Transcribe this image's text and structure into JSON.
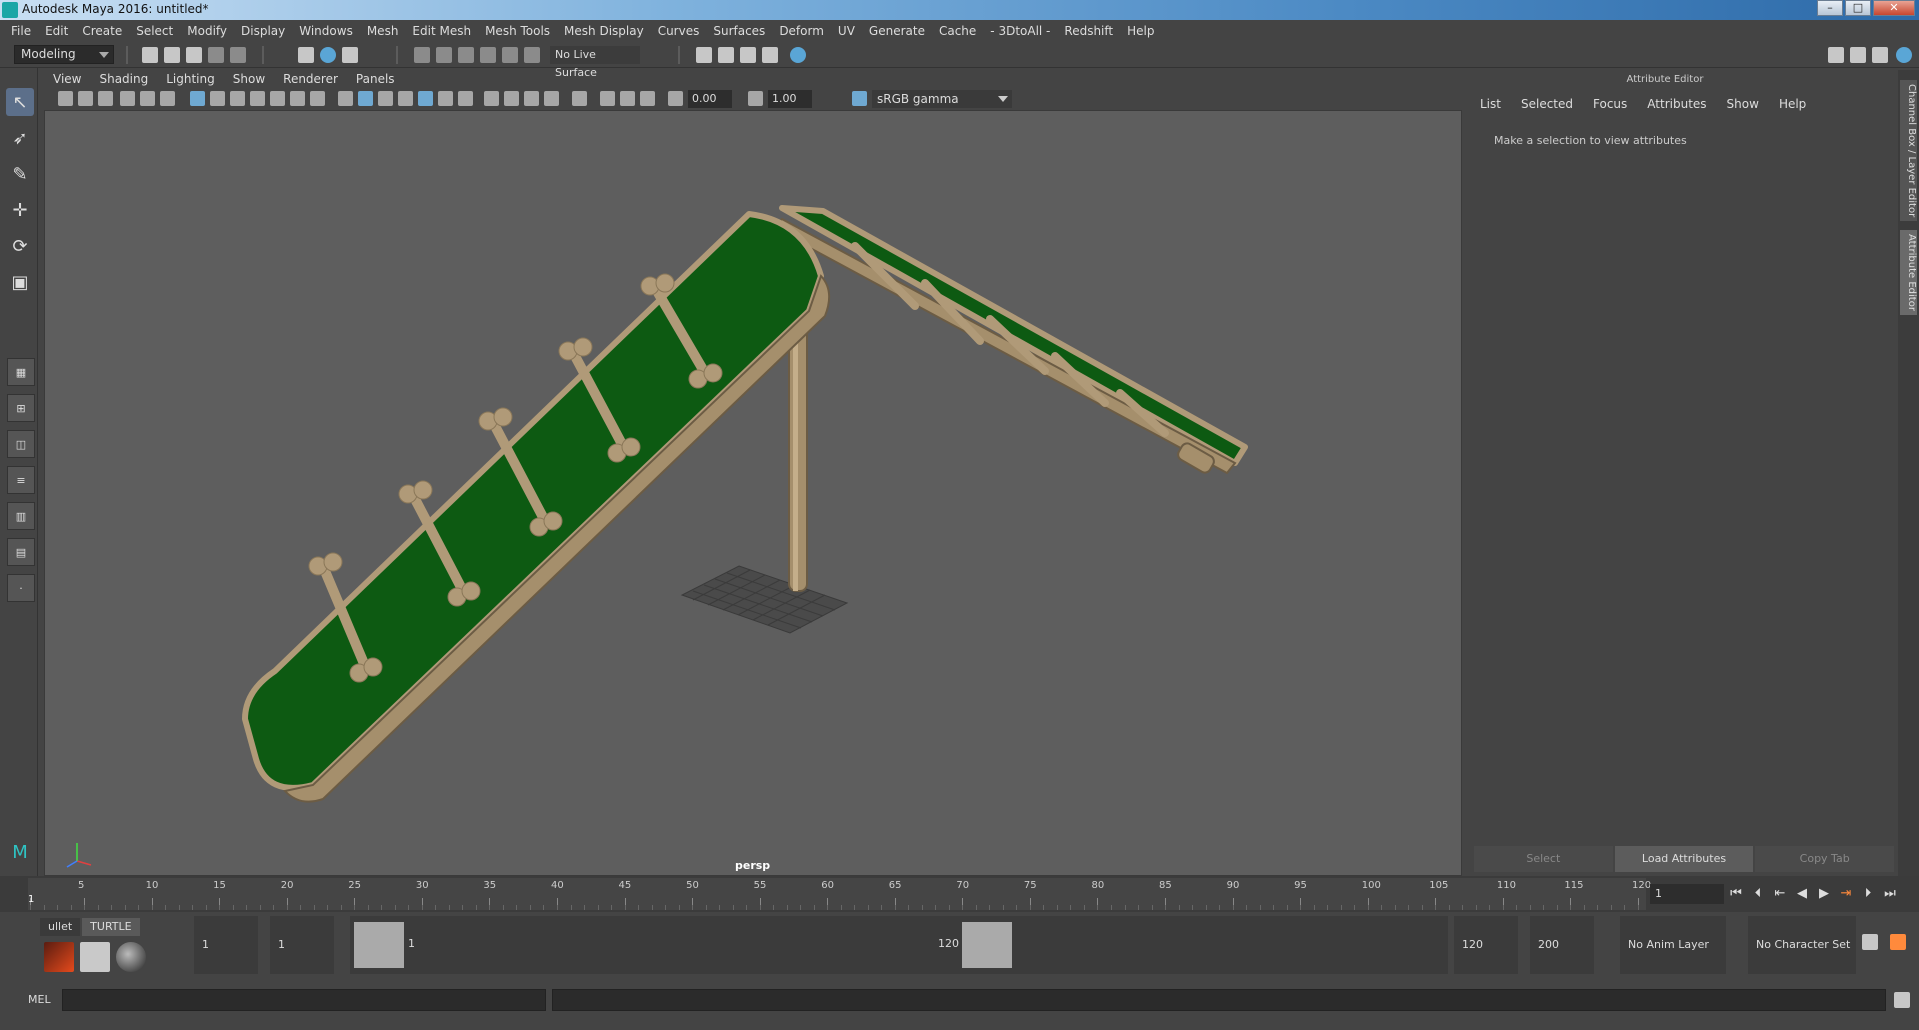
{
  "window": {
    "title": "Autodesk Maya 2016: untitled*",
    "minimize": "–",
    "maximize": "□",
    "close": "✕"
  },
  "menubar": [
    "File",
    "Edit",
    "Create",
    "Select",
    "Modify",
    "Display",
    "Windows",
    "Mesh",
    "Edit Mesh",
    "Mesh Tools",
    "Mesh Display",
    "Curves",
    "Surfaces",
    "Deform",
    "UV",
    "Generate",
    "Cache",
    "- 3DtoAll -",
    "Redshift",
    "Help"
  ],
  "toolbar": {
    "mode": "Modeling",
    "live_surface": "No Live Surface"
  },
  "panel_menus": [
    "View",
    "Shading",
    "Lighting",
    "Show",
    "Renderer",
    "Panels"
  ],
  "viewport_toolbar": {
    "exposure": "0.00",
    "gamma": "1.00",
    "color_space": "sRGB gamma"
  },
  "viewport": {
    "camera_label": "persp",
    "axis_x": "x",
    "axis_y": "y",
    "axis_z": "z"
  },
  "attribute_editor": {
    "title": "Attribute Editor",
    "menus": [
      "List",
      "Selected",
      "Focus",
      "Attributes",
      "Show",
      "Help"
    ],
    "message": "Make a selection to view attributes",
    "buttons": {
      "select": "Select",
      "load": "Load Attributes",
      "copy": "Copy Tab"
    }
  },
  "side_tabs": {
    "channel_box": "Channel Box / Layer Editor",
    "attribute_editor": "Attribute Editor"
  },
  "timeline": {
    "ticks": [
      "1",
      "5",
      "10",
      "15",
      "20",
      "25",
      "30",
      "35",
      "40",
      "45",
      "50",
      "55",
      "60",
      "65",
      "70",
      "75",
      "80",
      "85",
      "90",
      "95",
      "100",
      "105",
      "110",
      "115",
      "120"
    ],
    "current_frame": "1",
    "frame_field": "1"
  },
  "range": {
    "shelf_tabs": [
      "ullet",
      "TURTLE"
    ],
    "start": "1",
    "playback_start": "1",
    "range_start_label": "1",
    "range_end_label": "120",
    "playback_end": "120",
    "end": "200",
    "anim_layer": "No Anim Layer",
    "character_set": "No Character Set"
  },
  "cmdline": {
    "label": "MEL"
  },
  "colors": {
    "ramp_green": "#0d5a12",
    "frame_tan": "#b09a78",
    "viewport_bg": "#5e5e5e"
  }
}
